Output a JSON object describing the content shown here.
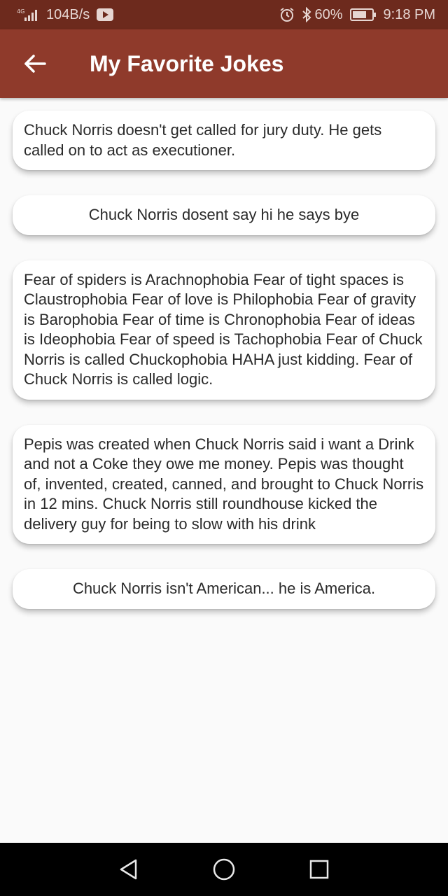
{
  "status_bar": {
    "network": "4G",
    "speed": "104B/s",
    "battery": "60%",
    "time": "9:18 PM",
    "icons": [
      "signal-icon",
      "youtube-icon",
      "alarm-icon",
      "bluetooth-icon",
      "battery-icon"
    ]
  },
  "app_bar": {
    "title": "My Favorite Jokes",
    "back_icon": "arrow-left-icon",
    "background": "#8f3a2b"
  },
  "jokes": [
    "Chuck Norris doesn't get called for jury duty. He gets called on to act as executioner.",
    "Chuck Norris dosent say hi he says bye",
    "Fear of spiders is Arachnophobia Fear of tight spaces is Claustrophobia Fear of love is Philophobia Fear of gravity is Barophobia Fear of time is Chronophobia Fear of ideas is Ideophobia Fear of speed is Tachophobia Fear of Chuck Norris is called Chuckophobia HAHA just kidding. Fear of Chuck Norris is called logic.",
    "Pepis was created when Chuck Norris said i want a Drink and not a Coke they owe me money. Pepis was thought of, invented, created, canned, and brought to Chuck Norris in 12 mins. Chuck Norris still roundhouse kicked the delivery guy for being to slow with his drink",
    "Chuck Norris isn't American... he is America."
  ],
  "nav_bar": {
    "icons": [
      "back-triangle-icon",
      "home-circle-icon",
      "recents-square-icon"
    ]
  }
}
